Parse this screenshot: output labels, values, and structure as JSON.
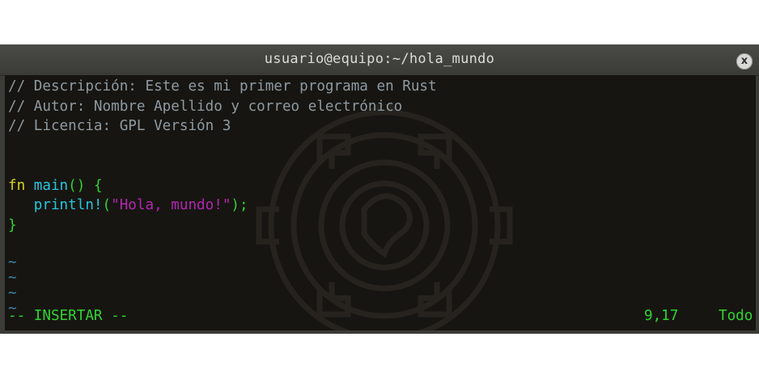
{
  "window": {
    "title": "usuario@equipo:~/hola_mundo",
    "close_label": "x"
  },
  "editor": {
    "comments": [
      "// Descripción: Este es mi primer programa en Rust",
      "// Autor: Nombre Apellido y correo electrónico",
      "// Licencia: GPL Versión 3"
    ],
    "code": {
      "fn_keyword": "fn",
      "fn_name": "main",
      "fn_parens": "()",
      "open_brace": "{",
      "macro": "println!",
      "macro_open": "(",
      "string": "\"Hola, mundo!\"",
      "macro_close": ");",
      "close_brace": "}"
    },
    "empty_line_marker": "~",
    "empty_line_count": 4
  },
  "statusbar": {
    "mode": "-- INSERTAR --",
    "cursor_position": "9,17",
    "scroll_position": "Todo"
  },
  "colors": {
    "terminal_bg": "#171511",
    "comment": "#8e9aa3",
    "keyword": "#d6d41a",
    "function": "#24c6de",
    "punctuation": "#2fd52f",
    "string": "#b227b2"
  }
}
